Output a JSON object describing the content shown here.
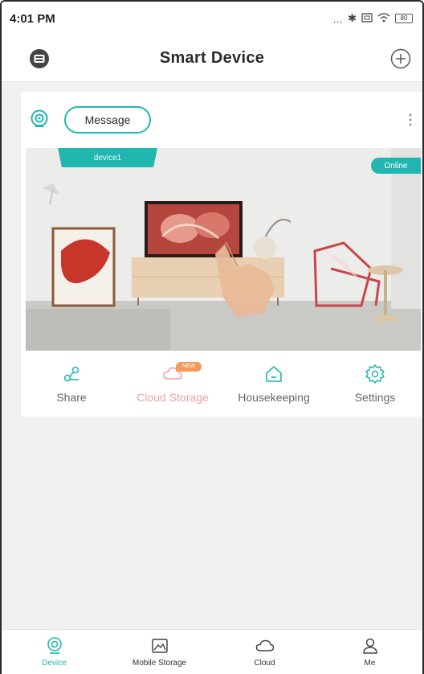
{
  "status_bar": {
    "time": "4:01 PM",
    "icons": [
      "more-dots-icon",
      "bluetooth-icon",
      "sim-icon",
      "wifi-icon",
      "battery-icon"
    ],
    "battery_label": "80"
  },
  "header": {
    "title": "Smart Device",
    "left_icon": "scan-box-icon",
    "right_icon": "add-circle-icon"
  },
  "device_card": {
    "message_label": "Message",
    "device_name": "device1",
    "status": "Online",
    "actions": [
      {
        "label": "Share",
        "icon": "share-icon"
      },
      {
        "label": "Cloud Storage",
        "icon": "cloud-icon",
        "badge": "NEW"
      },
      {
        "label": "Housekeeping",
        "icon": "home-icon"
      },
      {
        "label": "Settings",
        "icon": "gear-icon"
      }
    ]
  },
  "bottom_nav": [
    {
      "label": "Device",
      "icon": "camera-icon",
      "active": true
    },
    {
      "label": "Mobile Storage",
      "icon": "image-icon",
      "active": false
    },
    {
      "label": "Cloud",
      "icon": "cloud-icon",
      "active": false
    },
    {
      "label": "Me",
      "icon": "person-icon",
      "active": false
    }
  ],
  "colors": {
    "accent": "#22b6b1",
    "cloud_text": "#f0a0a0",
    "badge": "#f29a5a",
    "background": "#f1f1f1"
  }
}
